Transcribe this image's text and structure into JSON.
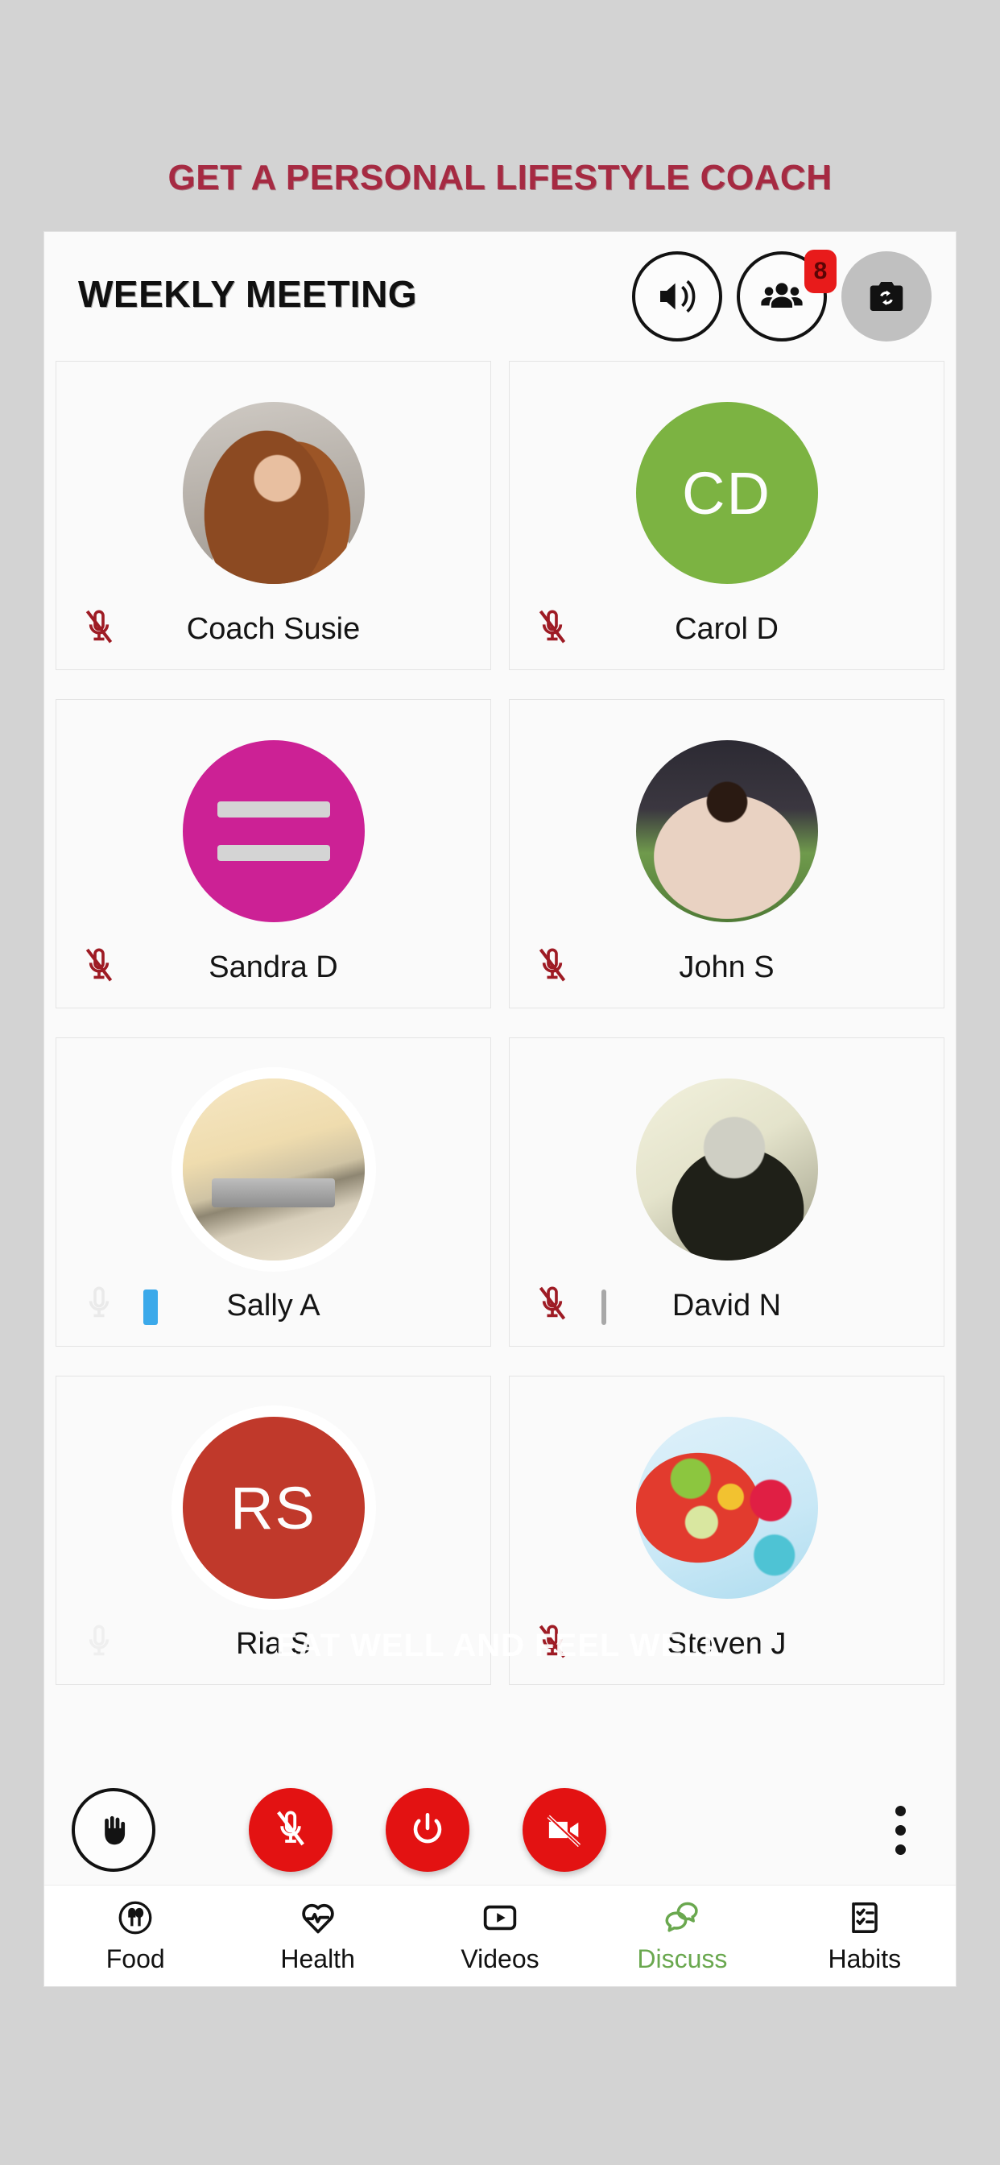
{
  "promo": {
    "headline": "GET A PERSONAL LIFESTYLE COACH",
    "overlay_text": "EAT WELL AND FEEL WELL",
    "headline_color": "#a62a42"
  },
  "header": {
    "title": "WEEKLY MEETING",
    "actions": [
      {
        "name": "speaker-icon",
        "label": "Speaker"
      },
      {
        "name": "participants-icon",
        "label": "Participants",
        "badge": "8"
      },
      {
        "name": "switch-camera-icon",
        "label": "Switch camera"
      }
    ],
    "participant_badge_count": "8",
    "badge_color": "#e81b1b"
  },
  "participants": [
    {
      "name": "Coach Susie",
      "avatar_kind": "photo",
      "photo": "ph-susie",
      "initials": "",
      "avatar_color": "",
      "muted": true,
      "halo": false,
      "level_bar": null
    },
    {
      "name": "Carol D",
      "avatar_kind": "initials",
      "photo": "",
      "initials": "CD",
      "avatar_color": "#7cb342",
      "muted": true,
      "halo": false,
      "level_bar": null
    },
    {
      "name": "Sandra D",
      "avatar_kind": "placeholder",
      "photo": "",
      "initials": "",
      "avatar_color": "#cc2195",
      "muted": true,
      "halo": false,
      "level_bar": null
    },
    {
      "name": "John S",
      "avatar_kind": "photo",
      "photo": "ph-john",
      "initials": "",
      "avatar_color": "",
      "muted": true,
      "halo": false,
      "level_bar": null
    },
    {
      "name": "Sally A",
      "avatar_kind": "photo",
      "photo": "ph-sally",
      "initials": "",
      "avatar_color": "",
      "muted": false,
      "halo": true,
      "level_bar": "#3ba9ea"
    },
    {
      "name": "David N",
      "avatar_kind": "photo",
      "photo": "ph-david",
      "initials": "",
      "avatar_color": "",
      "muted": true,
      "halo": false,
      "level_bar": "#bdbdbd"
    },
    {
      "name": "Ria S",
      "avatar_kind": "initials",
      "photo": "",
      "initials": "RS",
      "avatar_color": "#c0392b",
      "muted": false,
      "halo": true,
      "level_bar": null
    },
    {
      "name": "Steven J",
      "avatar_kind": "photo",
      "photo": "ph-steven",
      "initials": "",
      "avatar_color": "",
      "muted": true,
      "halo": false,
      "level_bar": null
    }
  ],
  "call_controls": [
    {
      "name": "raise-hand-button",
      "label": "Raise hand",
      "style": "hand"
    },
    {
      "name": "mute-mic-button",
      "label": "Mute",
      "style": "red"
    },
    {
      "name": "end-call-button",
      "label": "End call",
      "style": "red"
    },
    {
      "name": "stop-video-button",
      "label": "Stop video",
      "style": "red"
    },
    {
      "name": "more-options-button",
      "label": "More options",
      "style": "more"
    }
  ],
  "bottom_nav": {
    "active": "Discuss",
    "active_color": "#6aa84f",
    "items": [
      {
        "label": "Food",
        "icon": "plate-cutlery-icon"
      },
      {
        "label": "Health",
        "icon": "heart-pulse-icon"
      },
      {
        "label": "Videos",
        "icon": "video-play-icon"
      },
      {
        "label": "Discuss",
        "icon": "chat-bubbles-icon"
      },
      {
        "label": "Habits",
        "icon": "checklist-icon"
      }
    ]
  }
}
